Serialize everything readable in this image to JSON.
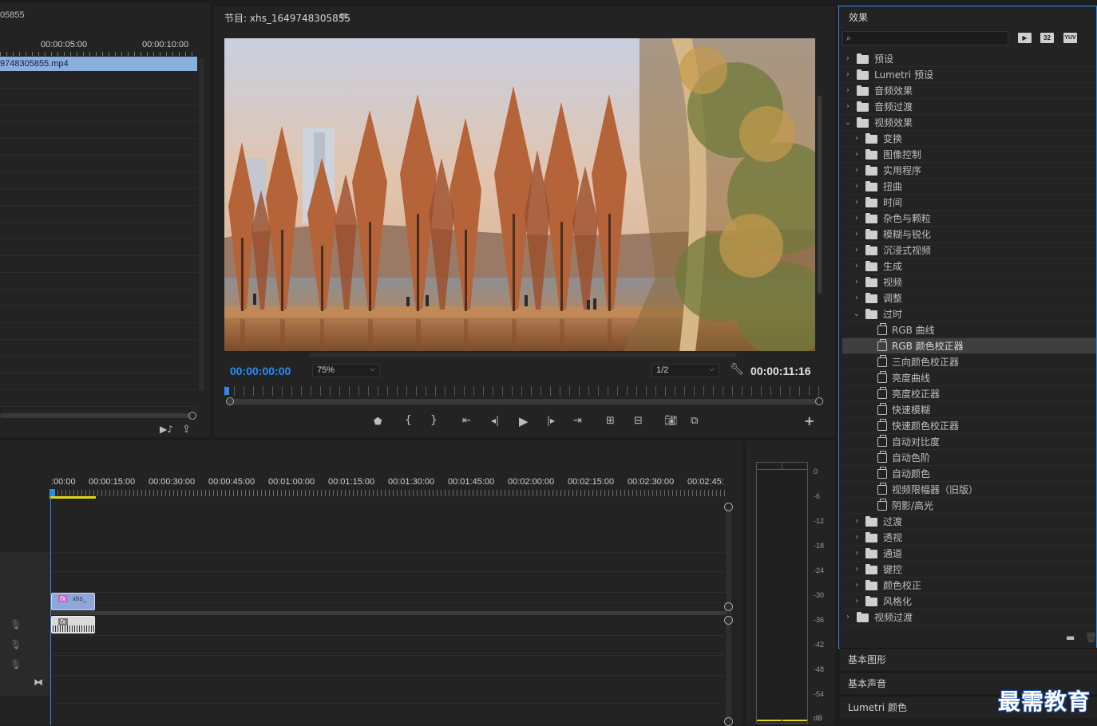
{
  "source_panel": {
    "title_fragment": "05855",
    "ruler": [
      "00:00:05:00",
      "00:00:10:00"
    ],
    "clip_name": "9748305855.mp4"
  },
  "program": {
    "title": "节目: xhs_1649748305855",
    "menu_icon": "hamburger-icon",
    "timecode_current": "00:00:00:00",
    "zoom": "75%",
    "resolution": "1/2",
    "timecode_duration": "00:00:11:16",
    "controls": [
      "marker-icon",
      "mark-in-icon",
      "mark-out-icon",
      "go-to-in-icon",
      "step-back-icon",
      "play-icon",
      "step-forward-icon",
      "go-to-out-icon",
      "lift-icon",
      "extract-icon",
      "camera-icon",
      "compare-icon",
      "add-icon"
    ]
  },
  "timeline": {
    "ruler": [
      ":00:00",
      "00:00:15:00",
      "00:00:30:00",
      "00:00:45:00",
      "00:01:00:00",
      "00:01:15:00",
      "00:01:30:00",
      "00:01:45:00",
      "00:02:00:00",
      "00:02:15:00",
      "00:02:30:00",
      "00:02:45:"
    ],
    "video_clip_label": "xhs_",
    "fx_badge": "fx"
  },
  "audio_meter": {
    "scale": [
      "0",
      "-6",
      "-12",
      "-18",
      "-24",
      "-30",
      "-36",
      "-42",
      "-48",
      "-54",
      "dB"
    ]
  },
  "effects": {
    "title": "效果",
    "search_placeholder": "",
    "filter_buttons": [
      "accelerated-effects-icon",
      "32-bit-icon",
      "yuv-icon"
    ],
    "filter_labels": [
      "32",
      "YUV"
    ],
    "tree": [
      {
        "label": "预设",
        "level": 0,
        "type": "preset",
        "expanded": false
      },
      {
        "label": "Lumetri 预设",
        "level": 0,
        "type": "preset",
        "expanded": false
      },
      {
        "label": "音频效果",
        "level": 0,
        "type": "folder",
        "expanded": false
      },
      {
        "label": "音频过渡",
        "level": 0,
        "type": "folder",
        "expanded": false
      },
      {
        "label": "视频效果",
        "level": 0,
        "type": "folder",
        "expanded": true
      },
      {
        "label": "变换",
        "level": 1,
        "type": "folder",
        "expanded": false
      },
      {
        "label": "图像控制",
        "level": 1,
        "type": "folder",
        "expanded": false
      },
      {
        "label": "实用程序",
        "level": 1,
        "type": "folder",
        "expanded": false
      },
      {
        "label": "扭曲",
        "level": 1,
        "type": "folder",
        "expanded": false
      },
      {
        "label": "时间",
        "level": 1,
        "type": "folder",
        "expanded": false
      },
      {
        "label": "杂色与颗粒",
        "level": 1,
        "type": "folder",
        "expanded": false
      },
      {
        "label": "模糊与锐化",
        "level": 1,
        "type": "folder",
        "expanded": false
      },
      {
        "label": "沉浸式视频",
        "level": 1,
        "type": "folder",
        "expanded": false
      },
      {
        "label": "生成",
        "level": 1,
        "type": "folder",
        "expanded": false
      },
      {
        "label": "视频",
        "level": 1,
        "type": "folder",
        "expanded": false
      },
      {
        "label": "调整",
        "level": 1,
        "type": "folder",
        "expanded": false
      },
      {
        "label": "过时",
        "level": 1,
        "type": "folder",
        "expanded": true
      },
      {
        "label": "RGB 曲线",
        "level": 2,
        "type": "effect"
      },
      {
        "label": "RGB 颜色校正器",
        "level": 2,
        "type": "effect",
        "selected": true
      },
      {
        "label": "三向颜色校正器",
        "level": 2,
        "type": "effect"
      },
      {
        "label": "亮度曲线",
        "level": 2,
        "type": "effect"
      },
      {
        "label": "亮度校正器",
        "level": 2,
        "type": "effect"
      },
      {
        "label": "快速模糊",
        "level": 2,
        "type": "effect"
      },
      {
        "label": "快速颜色校正器",
        "level": 2,
        "type": "effect"
      },
      {
        "label": "自动对比度",
        "level": 2,
        "type": "effect"
      },
      {
        "label": "自动色阶",
        "level": 2,
        "type": "effect"
      },
      {
        "label": "自动颜色",
        "level": 2,
        "type": "effect"
      },
      {
        "label": "视频限幅器（旧版）",
        "level": 2,
        "type": "effect"
      },
      {
        "label": "阴影/高光",
        "level": 2,
        "type": "effect"
      },
      {
        "label": "过渡",
        "level": 1,
        "type": "folder",
        "expanded": false
      },
      {
        "label": "透视",
        "level": 1,
        "type": "folder",
        "expanded": false
      },
      {
        "label": "通道",
        "level": 1,
        "type": "folder",
        "expanded": false
      },
      {
        "label": "键控",
        "level": 1,
        "type": "folder",
        "expanded": false
      },
      {
        "label": "颜色校正",
        "level": 1,
        "type": "folder",
        "expanded": false
      },
      {
        "label": "风格化",
        "level": 1,
        "type": "folder",
        "expanded": false
      },
      {
        "label": "视频过渡",
        "level": 0,
        "type": "folder",
        "expanded": false
      }
    ]
  },
  "sections": [
    "基本图形",
    "基本声音",
    "Lumetri 颜色"
  ],
  "watermark": "最需教育",
  "colors": {
    "accent_blue": "#2d8ceb",
    "clip_video": "#8fa6d8",
    "clip_fx": "#c06ad0",
    "panel_bg": "#232323"
  }
}
